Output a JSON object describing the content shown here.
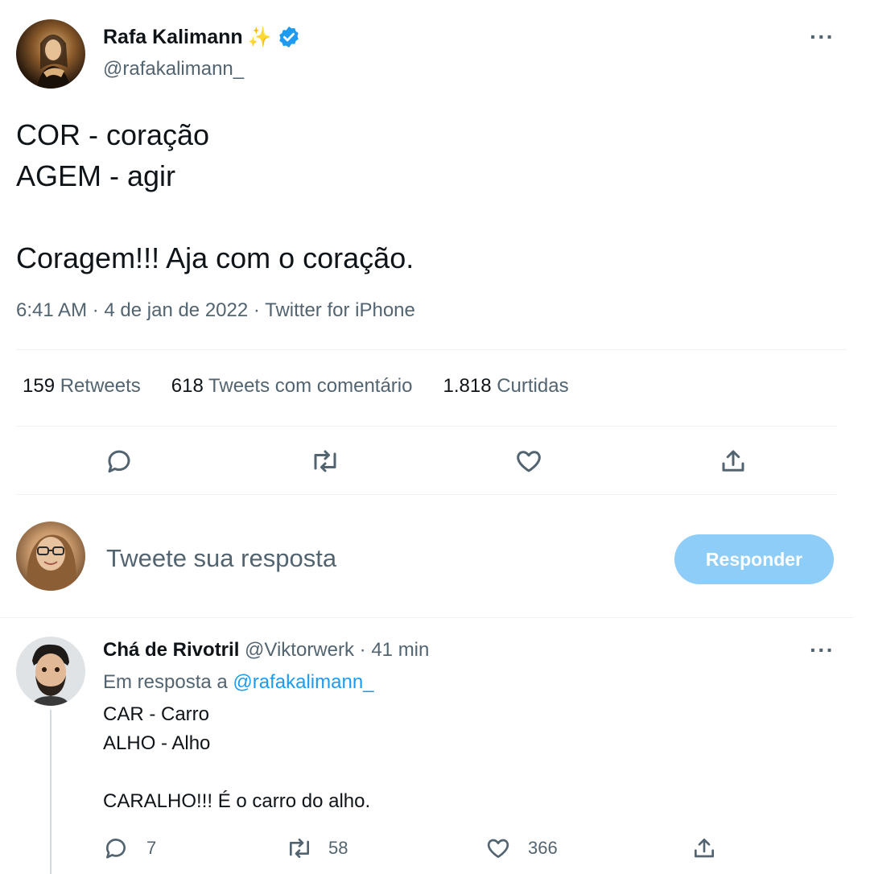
{
  "main_tweet": {
    "author_name": "Rafa Kalimann",
    "name_emoji": "✨",
    "handle": "@rafakalimann_",
    "lines": [
      "COR - coração",
      "AGEM - agir",
      "",
      "Coragem!!! Aja com o coração."
    ],
    "meta": "6:41 AM · 4 de jan de 2022 · Twitter for iPhone",
    "stats": [
      {
        "count": "159",
        "label": "Retweets"
      },
      {
        "count": "618",
        "label": "Tweets com comentário"
      },
      {
        "count": "1.818",
        "label": "Curtidas"
      }
    ]
  },
  "compose": {
    "placeholder": "Tweete sua resposta",
    "button_label": "Responder"
  },
  "reply": {
    "author_name": "Chá de Rivotril",
    "handle": "@Viktorwerk",
    "separator": "·",
    "time": "41 min",
    "replying_prefix": "Em resposta a",
    "replying_to": "@rafakalimann_",
    "lines": [
      "CAR - Carro",
      "ALHO - Alho",
      "",
      "CARALHO!!! É o carro do alho."
    ],
    "counts": {
      "replies": "7",
      "retweets": "58",
      "likes": "366"
    }
  },
  "colors": {
    "accent": "#1d9bf0",
    "button_disabled": "#8ecdf8",
    "text_secondary": "#536471"
  }
}
